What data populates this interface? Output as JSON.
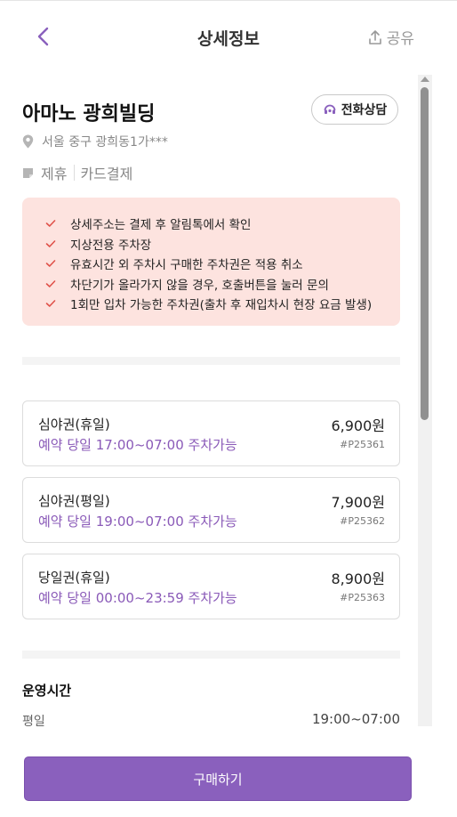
{
  "header": {
    "title": "상세정보",
    "share_label": "공유"
  },
  "parking": {
    "name": "아마노 광희빌딩",
    "call_label": "전화상담",
    "address": "서울 중구 광희동1가***",
    "tags": [
      "제휴",
      "카드결제"
    ]
  },
  "notices": [
    "상세주소는 결제 후 알림톡에서 확인",
    "지상전용 주차장",
    "유효시간 외 주차시 구매한 주차권은 적용 취소",
    "차단기가 올라가지 않을 경우, 호출버튼을 눌러 문의",
    "1회만 입차 가능한 주차권(출차 후 재입차시 현장 요금 발생)"
  ],
  "tickets": [
    {
      "name": "심야권(휴일)",
      "price": "6,900원",
      "time": "예약 당일 17:00~07:00 주차가능",
      "code": "#P25361"
    },
    {
      "name": "심야권(평일)",
      "price": "7,900원",
      "time": "예약 당일 19:00~07:00 주차가능",
      "code": "#P25362"
    },
    {
      "name": "당일권(휴일)",
      "price": "8,900원",
      "time": "예약 당일 00:00~23:59 주차가능",
      "code": "#P25363"
    }
  ],
  "hours": {
    "title": "운영시간",
    "rows": [
      {
        "label": "평일",
        "value": "19:00~07:00"
      }
    ]
  },
  "footer": {
    "buy_label": "구매하기"
  },
  "colors": {
    "accent": "#8a60bd",
    "notice_bg": "#fde3df",
    "check": "#e0524a"
  }
}
